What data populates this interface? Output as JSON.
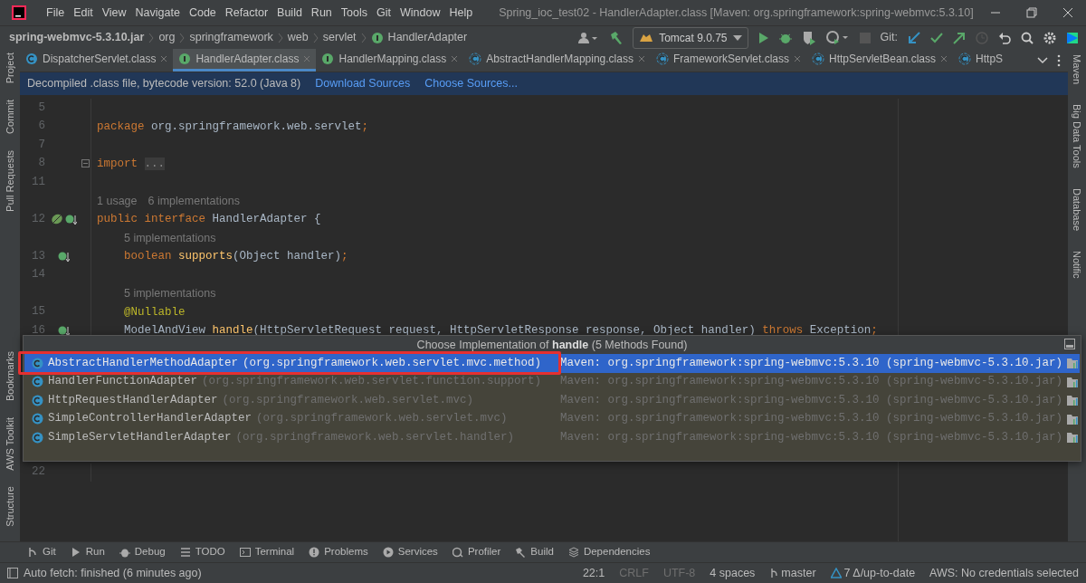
{
  "window": {
    "menu": [
      "File",
      "Edit",
      "View",
      "Navigate",
      "Code",
      "Refactor",
      "Build",
      "Run",
      "Tools",
      "Git",
      "Window",
      "Help"
    ],
    "title": "Spring_ioc_test02 - HandlerAdapter.class [Maven: org.springframework:spring-webmvc:5.3.10]"
  },
  "navbar": {
    "breadcrumbs": [
      "spring-webmvc-5.3.10.jar",
      "org",
      "springframework",
      "web",
      "servlet",
      "HandlerAdapter"
    ],
    "run_config": "Tomcat 9.0.75",
    "git_label": "Git:"
  },
  "tabs": [
    {
      "label": "DispatcherServlet.class",
      "kind": "class",
      "selected": false
    },
    {
      "label": "HandlerAdapter.class",
      "kind": "interface",
      "selected": true
    },
    {
      "label": "HandlerMapping.class",
      "kind": "interface",
      "selected": false
    },
    {
      "label": "AbstractHandlerMapping.class",
      "kind": "abstract",
      "selected": false
    },
    {
      "label": "FrameworkServlet.class",
      "kind": "abstract",
      "selected": false
    },
    {
      "label": "HttpServletBean.class",
      "kind": "abstract",
      "selected": false
    },
    {
      "label": "HttpS",
      "kind": "abstract",
      "selected": false
    }
  ],
  "banner": {
    "text": "Decompiled .class file, bytecode version: 52.0 (Java 8)",
    "links": [
      "Download Sources",
      "Choose Sources..."
    ]
  },
  "left_tools": {
    "top": [
      "Project",
      "Commit",
      "Pull Requests"
    ],
    "bottom": [
      "Bookmarks",
      "AWS Toolkit",
      "Structure"
    ]
  },
  "right_tools": [
    "Maven",
    "Big Data Tools",
    "Database",
    "Notific"
  ],
  "editor": {
    "lines": [
      {
        "kind": "code",
        "number": "5"
      },
      {
        "kind": "code",
        "number": "6",
        "tokens": [
          {
            "t": "package",
            "kind": "keyword"
          },
          {
            "t": " org.springframework.web.servlet",
            "kind": "plain"
          },
          {
            "t": ";",
            "kind": "keyword"
          }
        ]
      },
      {
        "kind": "code",
        "number": "7"
      },
      {
        "kind": "code",
        "number": "8",
        "fold": true,
        "tokens": [
          {
            "t": "import",
            "kind": "keyword"
          },
          {
            "t": "...",
            "kind": "folded"
          }
        ]
      },
      {
        "kind": "code",
        "number": "11"
      },
      {
        "kind": "hint",
        "texts": [
          "1 usage",
          "6 implementations"
        ]
      },
      {
        "kind": "code",
        "number": "12",
        "gutter": [
          {
            "kind": "bean"
          },
          {
            "kind": "implemented"
          }
        ],
        "tokens": [
          {
            "t": "public interface",
            "kind": "keyword"
          },
          {
            "t": " HandlerAdapter {",
            "kind": "plain"
          }
        ]
      },
      {
        "kind": "member_hint",
        "texts": [
          "5 implementations"
        ]
      },
      {
        "kind": "code",
        "number": "13",
        "gutter": [
          {
            "kind": "implemented"
          }
        ],
        "tokens": [
          {
            "t": "    boolean",
            "kind": "keyword"
          },
          {
            "t": " supports",
            "kind": "method"
          },
          {
            "t": "(Object handler)",
            "kind": "plain"
          },
          {
            "t": ";",
            "kind": "keyword"
          }
        ]
      },
      {
        "kind": "code",
        "number": "14"
      },
      {
        "kind": "member_hint",
        "texts": [
          "5 implementations"
        ]
      },
      {
        "kind": "code",
        "number": "15",
        "tokens": [
          {
            "t": "    @Nullable",
            "kind": "annotation"
          }
        ]
      },
      {
        "kind": "code",
        "number": "16",
        "gutter": [
          {
            "kind": "implemented"
          }
        ],
        "tokens": [
          {
            "t": "    ModelAndView",
            "kind": "plain"
          },
          {
            "t": " handle",
            "kind": "method"
          },
          {
            "t": "(HttpServletRequest request, HttpServletResponse response, Object handler) ",
            "kind": "plain"
          },
          {
            "t": "throws",
            "kind": "keyword"
          },
          {
            "t": " Exception",
            "kind": "plain"
          },
          {
            "t": ";",
            "kind": "keyword"
          }
        ]
      }
    ],
    "lines_below_popup": [
      {
        "kind": "code",
        "number": "22"
      }
    ]
  },
  "popup": {
    "title": "Choose Implementation of **handle** (5 Methods Found)",
    "items": [
      {
        "name": "AbstractHandlerMethodAdapter",
        "package": "(org.springframework.web.servlet.mvc.method)",
        "location": "Maven: org.springframework:spring-webmvc:5.3.10 (spring-webmvc-5.3.10.jar)",
        "selected": true,
        "outlined": true
      },
      {
        "name": "HandlerFunctionAdapter",
        "package": "(org.springframework.web.servlet.function.support)",
        "location": "Maven: org.springframework:spring-webmvc:5.3.10 (spring-webmvc-5.3.10.jar)",
        "selected": false,
        "outlined": false
      },
      {
        "name": "HttpRequestHandlerAdapter",
        "package": "(org.springframework.web.servlet.mvc)",
        "location": "Maven: org.springframework:spring-webmvc:5.3.10 (spring-webmvc-5.3.10.jar)",
        "selected": false,
        "outlined": false
      },
      {
        "name": "SimpleControllerHandlerAdapter",
        "package": "(org.springframework.web.servlet.mvc)",
        "location": "Maven: org.springframework:spring-webmvc:5.3.10 (spring-webmvc-5.3.10.jar)",
        "selected": false,
        "outlined": false
      },
      {
        "name": "SimpleServletHandlerAdapter",
        "package": "(org.springframework.web.servlet.handler)",
        "location": "Maven: org.springframework:spring-webmvc:5.3.10 (spring-webmvc-5.3.10.jar)",
        "selected": false,
        "outlined": false
      }
    ]
  },
  "bottom_tools": [
    {
      "label": "Git",
      "kind": "git"
    },
    {
      "label": "Run",
      "kind": "run"
    },
    {
      "label": "Debug",
      "kind": "debug"
    },
    {
      "label": "TODO",
      "kind": "list"
    },
    {
      "label": "Terminal",
      "kind": "terminal"
    },
    {
      "label": "Problems",
      "kind": "problems"
    },
    {
      "label": "Services",
      "kind": "services"
    },
    {
      "label": "Profiler",
      "kind": "profiler"
    },
    {
      "label": "Build",
      "kind": "build"
    },
    {
      "label": "Dependencies",
      "kind": "deps"
    }
  ],
  "status_bar": {
    "message": "Auto fetch: finished (6 minutes ago)",
    "items": [
      {
        "label": "22:1",
        "disabled": false,
        "kind": "text"
      },
      {
        "label": "CRLF",
        "disabled": true,
        "kind": "text"
      },
      {
        "label": "UTF-8",
        "disabled": true,
        "kind": "text"
      },
      {
        "label": "4 spaces",
        "disabled": false,
        "kind": "text"
      },
      {
        "label": "master",
        "disabled": false,
        "kind": "branch"
      },
      {
        "label": "7 Δ/up-to-date",
        "disabled": false,
        "kind": "vcs"
      },
      {
        "label": "AWS: No credentials selected",
        "disabled": false,
        "kind": "text"
      }
    ]
  }
}
